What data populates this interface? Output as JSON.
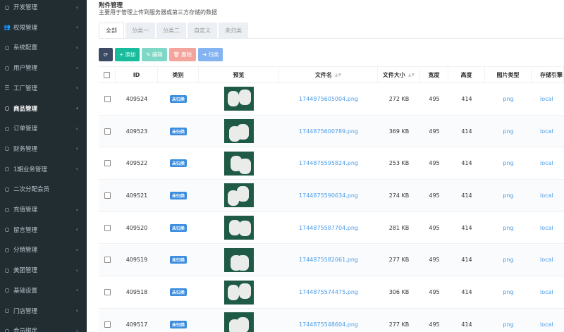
{
  "sidebar": {
    "items": [
      {
        "label": "开发管理",
        "icon": "circle-icon",
        "active": false
      },
      {
        "label": "权限管理",
        "icon": "group-icon",
        "active": false
      },
      {
        "label": "系统配置",
        "icon": "circle-icon",
        "active": false
      },
      {
        "label": "用户管理",
        "icon": "circle-icon",
        "active": false
      },
      {
        "label": "工厂管理",
        "icon": "list-icon",
        "active": false
      },
      {
        "label": "商品管理",
        "icon": "circle-icon",
        "active": true
      },
      {
        "label": "订单管理",
        "icon": "circle-icon",
        "active": false
      },
      {
        "label": "财务管理",
        "icon": "circle-icon",
        "active": false
      },
      {
        "label": "1期业务管理",
        "icon": "circle-icon",
        "active": false
      },
      {
        "label": "二次分配会员",
        "icon": "circle-icon",
        "active": false
      },
      {
        "label": "充值管理",
        "icon": "circle-icon",
        "active": false
      },
      {
        "label": "留言管理",
        "icon": "circle-icon",
        "active": false
      },
      {
        "label": "分销管理",
        "icon": "circle-icon",
        "active": false
      },
      {
        "label": "美团管理",
        "icon": "circle-icon",
        "active": false
      },
      {
        "label": "基础设置",
        "icon": "circle-icon",
        "active": false
      },
      {
        "label": "门店管理",
        "icon": "circle-icon",
        "active": false
      },
      {
        "label": "会员绑定",
        "icon": "circle-icon",
        "active": false
      }
    ]
  },
  "header": {
    "title": "附件管理",
    "description": "主要用于管理上传到服务器或第三方存储的数据"
  },
  "tabs": [
    {
      "label": "全部",
      "active": true
    },
    {
      "label": "分类一",
      "active": false
    },
    {
      "label": "分类二",
      "active": false
    },
    {
      "label": "自定义",
      "active": false
    },
    {
      "label": "未归类",
      "active": false
    }
  ],
  "toolbar": {
    "add_label": "添加",
    "edit_label": "编辑",
    "delete_label": "删除",
    "group_label": "归类"
  },
  "table": {
    "columns": {
      "id": "ID",
      "category": "类别",
      "preview": "预览",
      "filename": "文件名",
      "filesize": "文件大小",
      "width": "宽度",
      "height": "高度",
      "imagetype": "图片类型",
      "storage": "存储引擎"
    },
    "rows": [
      {
        "id": "409524",
        "category": "未归类",
        "filename": "1744875605004.png",
        "filesize": "272 KB",
        "width": "495",
        "height": "414",
        "imagetype": "png",
        "storage": "local"
      },
      {
        "id": "409523",
        "category": "未归类",
        "filename": "1744875600789.png",
        "filesize": "369 KB",
        "width": "495",
        "height": "414",
        "imagetype": "png",
        "storage": "local"
      },
      {
        "id": "409522",
        "category": "未归类",
        "filename": "1744875595824.png",
        "filesize": "253 KB",
        "width": "495",
        "height": "414",
        "imagetype": "png",
        "storage": "local"
      },
      {
        "id": "409521",
        "category": "未归类",
        "filename": "1744875590634.png",
        "filesize": "274 KB",
        "width": "495",
        "height": "414",
        "imagetype": "png",
        "storage": "local"
      },
      {
        "id": "409520",
        "category": "未归类",
        "filename": "1744875587704.png",
        "filesize": "281 KB",
        "width": "495",
        "height": "414",
        "imagetype": "png",
        "storage": "local"
      },
      {
        "id": "409519",
        "category": "未归类",
        "filename": "1744875582061.png",
        "filesize": "277 KB",
        "width": "495",
        "height": "414",
        "imagetype": "png",
        "storage": "local"
      },
      {
        "id": "409518",
        "category": "未归类",
        "filename": "1744875574475.png",
        "filesize": "306 KB",
        "width": "495",
        "height": "414",
        "imagetype": "png",
        "storage": "local"
      },
      {
        "id": "409517",
        "category": "未归类",
        "filename": "1744875548604.png",
        "filesize": "277 KB",
        "width": "495",
        "height": "414",
        "imagetype": "png",
        "storage": "local"
      }
    ]
  }
}
